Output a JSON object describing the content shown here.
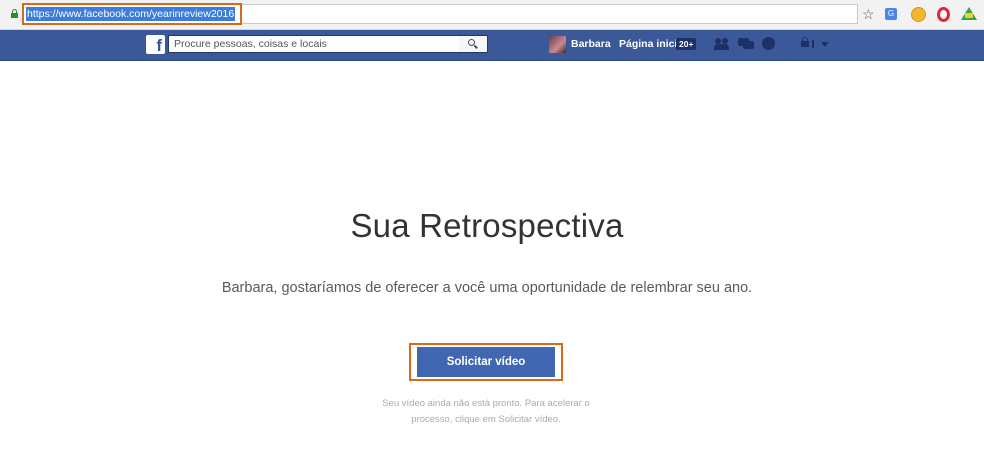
{
  "browser": {
    "url": "https://www.facebook.com/yearinreview2016",
    "icons": [
      "lock-icon",
      "star-icon",
      "translate-icon",
      "coin-extension-icon",
      "opera-icon",
      "drive-icon"
    ]
  },
  "facebook_bar": {
    "logo": "f",
    "search_placeholder": "Procure pessoas, coisas e locais",
    "user_name": "Barbara",
    "home_label": "Página inicial",
    "home_badge": "20+"
  },
  "main": {
    "title": "Sua Retrospectiva",
    "subtitle": "Barbara, gostaríamos de oferecer a você uma oportunidade de relembrar seu ano.",
    "button_label": "Solicitar vídeo",
    "note_line1": "Seu vídeo ainda não está pronto. Para acelerar o",
    "note_line2": "processo, clique em Solicitar vídeo."
  },
  "colors": {
    "facebook_blue": "#3b5998",
    "button_blue": "#4267b2",
    "highlight_orange": "#d86a1e",
    "url_selection": "#3b7dd8"
  }
}
